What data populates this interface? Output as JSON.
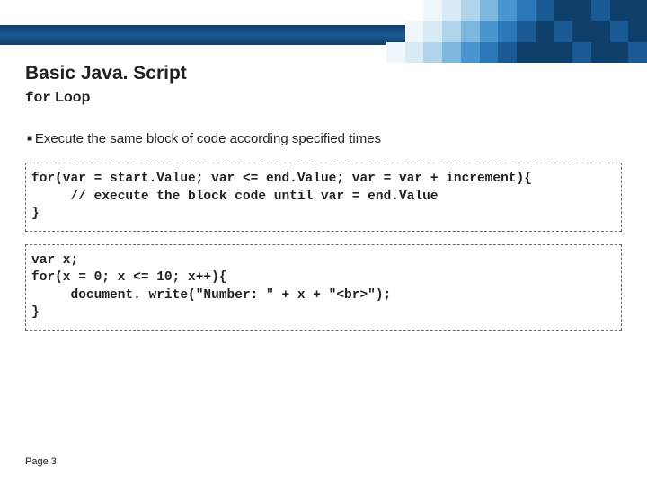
{
  "title": "Basic Java. Script",
  "subtitle_mono": "for",
  "subtitle_rest": " Loop",
  "bullet": "Execute the same block of code according specified times",
  "codebox1": "for(var = start.Value; var <= end.Value; var = var + increment){\n     // execute the block code until var = end.Value\n}",
  "codebox2": "var x;\nfor(x = 0; x <= 10; x++){\n     document. write(\"Number: \" + x + \"<br>\");\n}",
  "footer": "Page 3"
}
